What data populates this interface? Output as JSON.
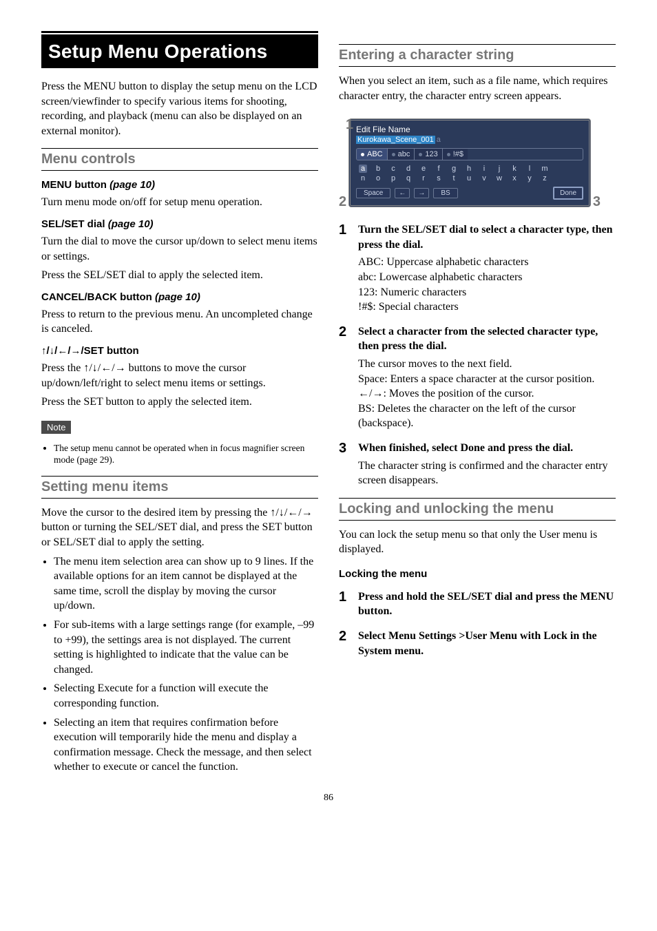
{
  "title": "Setup Menu Operations",
  "intro": "Press the MENU button to display the setup menu on the LCD screen/viewfinder to specify various items for shooting, recording, and playback (menu can also be displayed on an external monitor).",
  "section_menu_controls": "Menu controls",
  "menu_button": {
    "head": "MENU button",
    "ref": "(page 10)",
    "body": "Turn menu mode on/off for setup menu operation."
  },
  "sel_set_dial": {
    "head": "SEL/SET dial",
    "ref": "(page 10)",
    "body1": "Turn the dial to move the cursor up/down to select menu items or settings.",
    "body2": "Press the SEL/SET dial to apply the selected item."
  },
  "cancel_back": {
    "head": "CANCEL/BACK button",
    "ref": "(page 10)",
    "body": "Press to return to the previous menu. An uncompleted change is canceled."
  },
  "set_button": {
    "head": "↑/↓/←/→/SET button",
    "body1": "Press the ↑/↓/←/→ buttons to move the cursor up/down/left/right to select menu items or settings.",
    "body2": "Press the SET button to apply the selected item."
  },
  "note_label": "Note",
  "note_item": "The setup menu cannot be operated when in focus magnifier screen mode (page 29).",
  "section_setting_items": "Setting menu items",
  "setting_items_intro": "Move the cursor to the desired item by pressing the ↑/↓/←/→ button or turning the SEL/SET dial, and press the SET button or SEL/SET dial to apply the setting.",
  "setting_bullets": [
    "The menu item selection area can show up to 9 lines. If the available options for an item cannot be displayed at the same time, scroll the display by moving the cursor up/down.",
    "For sub-items with a large settings range (for example, –99 to +99), the settings area is not displayed. The current setting is highlighted to indicate that the value can be changed.",
    "Selecting Execute for a function will execute the corresponding function.",
    "Selecting an item that requires confirmation before execution will temporarily hide the menu and display a confirmation message. Check the message, and then select whether to execute or cancel the function."
  ],
  "section_entering": "Entering a character string",
  "entering_intro": "When you select an item, such as a file name, which requires character entry, the character entry screen appears.",
  "diagram": {
    "labels": {
      "one": "1",
      "two": "2",
      "three": "3"
    },
    "title": "Edit File Name",
    "subtitle_highlight": "Kurokawa_Scene_001",
    "subtitle_suffix": "a",
    "tabs": [
      "ABC",
      "abc",
      "123",
      "!#$"
    ],
    "row1": [
      "a",
      "b",
      "c",
      "d",
      "e",
      "f",
      "g",
      "h",
      "i",
      "j",
      "k",
      "l",
      "m"
    ],
    "row2": [
      "n",
      "o",
      "p",
      "q",
      "r",
      "s",
      "t",
      "u",
      "v",
      "w",
      "x",
      "y",
      "z"
    ],
    "btn_space": "Space",
    "btn_left": "←",
    "btn_right": "→",
    "btn_bs": "BS",
    "btn_done": "Done"
  },
  "steps": [
    {
      "num": "1",
      "title": "Turn the SEL/SET dial to select a character type, then press the dial.",
      "body": "ABC: Uppercase alphabetic characters\nabc: Lowercase alphabetic characters\n123: Numeric characters\n!#$: Special characters"
    },
    {
      "num": "2",
      "title": "Select a character from the selected character type, then press the dial.",
      "body": "The cursor moves to the next field.\nSpace: Enters a space character at the cursor position.\n←/→: Moves the position of the cursor.\nBS: Deletes the character on the left of the cursor (backspace)."
    },
    {
      "num": "3",
      "title": "When finished, select Done and press the dial.",
      "body": "The character string is confirmed and the character entry screen disappears."
    }
  ],
  "section_locking": "Locking and unlocking the menu",
  "locking_intro": "You can lock the setup menu so that only the User menu is displayed.",
  "locking_head": "Locking the menu",
  "lock_steps": [
    {
      "num": "1",
      "title": "Press and hold the SEL/SET dial and press the MENU button."
    },
    {
      "num": "2",
      "title": "Select Menu Settings >User Menu with Lock in the System menu."
    }
  ],
  "page_num": "86"
}
